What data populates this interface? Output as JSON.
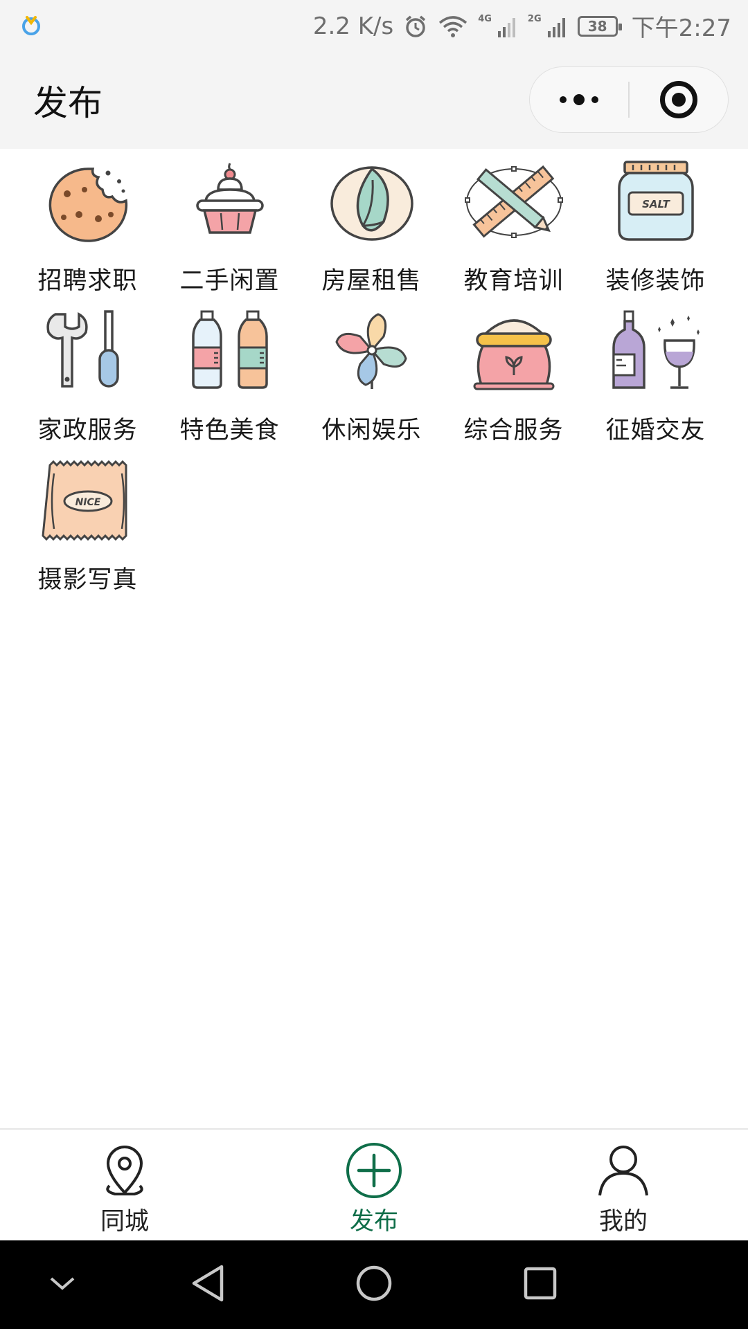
{
  "status_bar": {
    "speed": "2.2 K/s",
    "net1": "4G",
    "net2": "2G",
    "battery": "38",
    "time": "下午2:27"
  },
  "nav": {
    "title": "发布"
  },
  "categories": [
    {
      "label": "招聘求职",
      "icon": "cookie-icon"
    },
    {
      "label": "二手闲置",
      "icon": "cupcake-icon"
    },
    {
      "label": "房屋租售",
      "icon": "pistachio-icon"
    },
    {
      "label": "教育培训",
      "icon": "ruler-pencil-icon"
    },
    {
      "label": "装修装饰",
      "icon": "salt-jar-icon"
    },
    {
      "label": "家政服务",
      "icon": "wrench-screwdriver-icon"
    },
    {
      "label": "特色美食",
      "icon": "bottles-icon"
    },
    {
      "label": "休闲娱乐",
      "icon": "pinwheel-icon"
    },
    {
      "label": "综合服务",
      "icon": "flour-sack-icon"
    },
    {
      "label": "征婚交友",
      "icon": "wine-icon"
    },
    {
      "label": "摄影写真",
      "icon": "snack-bag-icon"
    }
  ],
  "snack_text": "NICE",
  "salt_text": "SALT",
  "tabs": [
    {
      "label": "同城",
      "icon": "location-pin-icon",
      "active": false
    },
    {
      "label": "发布",
      "icon": "plus-circle-icon",
      "active": true
    },
    {
      "label": "我的",
      "icon": "user-icon",
      "active": false
    }
  ],
  "colors": {
    "accent": "#0f6e49",
    "nav_bg": "#f4f4f4",
    "status_text": "#6e6e6e"
  }
}
